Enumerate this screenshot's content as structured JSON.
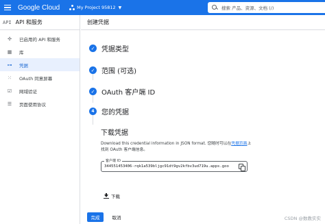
{
  "topbar": {
    "brand": "Google Cloud",
    "project": "My Project 95812",
    "search_placeholder": "搜索  产品、资源、文档 (/)"
  },
  "sidebar": {
    "api_label": "API",
    "title": "API 和服务",
    "items": [
      {
        "label": "已启用的 API 和服务",
        "icon": "settings-grid-icon"
      },
      {
        "label": "库",
        "icon": "library-icon"
      },
      {
        "label": "凭据",
        "icon": "key-icon",
        "active": true
      },
      {
        "label": "OAuth 同意屏幕",
        "icon": "consent-icon"
      },
      {
        "label": "网域验证",
        "icon": "domain-check-icon"
      },
      {
        "label": "页面使用协议",
        "icon": "agreement-icon"
      }
    ]
  },
  "main": {
    "title": "创建凭据",
    "steps": [
      {
        "label": "凭据类型",
        "state": "done"
      },
      {
        "label": "范围 (可选)",
        "state": "done"
      },
      {
        "label": "OAuth 客户端 ID",
        "state": "done"
      },
      {
        "label": "您的凭据",
        "state": "current",
        "number": "4"
      }
    ],
    "download": {
      "title": "下载凭据",
      "desc_before": "Download this credential information in JSON format. 您随时可以在",
      "desc_link": "凭据页面",
      "desc_after": "上找到 OAuth 客户端信息。",
      "client_label": "客户端 ID",
      "client_id": "344551453406-rqk1a539bljgc91dt9gv2kfbv3ud719u.apps.goo",
      "download_label": "下载"
    },
    "buttons": {
      "done": "完成",
      "cancel": "取消"
    }
  },
  "watermark": "CSDN @数教实实",
  "colors": {
    "accent": "#1a73e8",
    "active_bg": "#e8f0fe"
  }
}
